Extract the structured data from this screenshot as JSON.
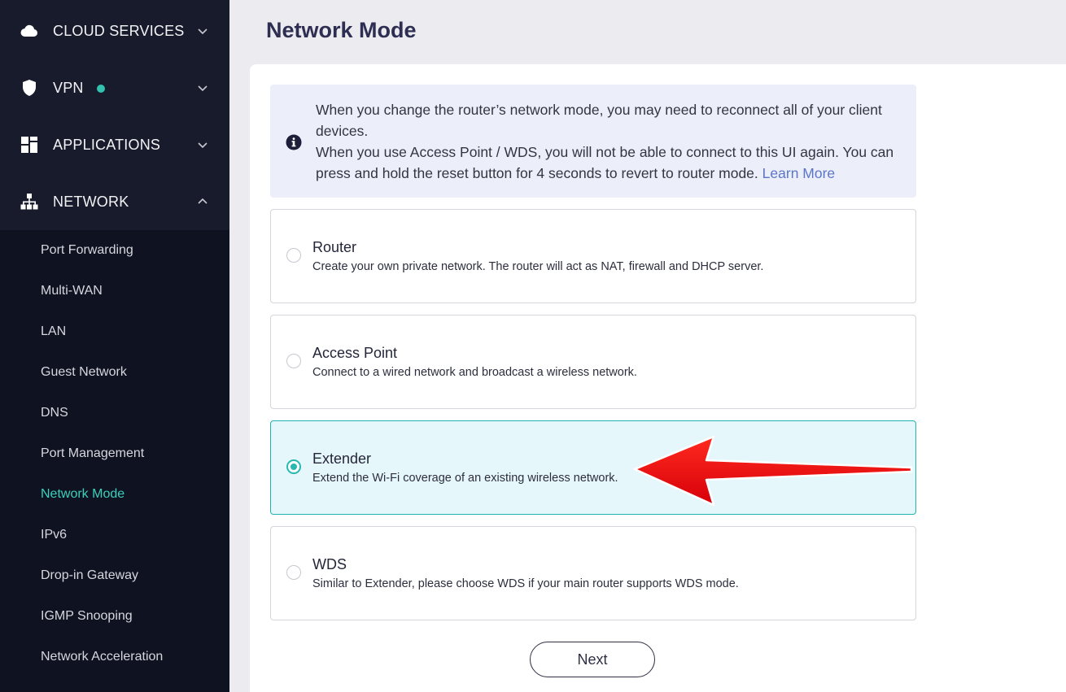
{
  "sidebar": {
    "sections": [
      {
        "label": "CLOUD SERVICES",
        "icon": "cloud-icon",
        "expanded": false
      },
      {
        "label": "VPN",
        "icon": "shield-icon",
        "expanded": false,
        "status_color": "#33c2b0"
      },
      {
        "label": "APPLICATIONS",
        "icon": "apps-grid-icon",
        "expanded": false
      },
      {
        "label": "NETWORK",
        "icon": "network-icon",
        "expanded": true
      }
    ],
    "network_items": [
      "Port Forwarding",
      "Multi-WAN",
      "LAN",
      "Guest Network",
      "DNS",
      "Port Management",
      "Network Mode",
      "IPv6",
      "Drop-in Gateway",
      "IGMP Snooping",
      "Network Acceleration"
    ],
    "active_item": "Network Mode"
  },
  "page": {
    "title": "Network Mode"
  },
  "info": {
    "icon": "info-icon",
    "line1": "When you change the router’s network mode, you may need to reconnect all of your client devices.",
    "line2": "When you use Access Point / WDS, you will not be able to connect to this UI again. You can press and hold the reset button for 4 seconds to revert to router mode.",
    "learn_more": "Learn More"
  },
  "options": [
    {
      "title": "Router",
      "desc": "Create your own private network. The router will act as NAT, firewall and DHCP server.",
      "selected": false
    },
    {
      "title": "Access Point",
      "desc": "Connect to a wired network and broadcast a wireless network.",
      "selected": false
    },
    {
      "title": "Extender",
      "desc": "Extend the Wi-Fi coverage of an existing wireless network.",
      "selected": true
    },
    {
      "title": "WDS",
      "desc": "Similar to Extender, please choose WDS if your main router supports WDS mode.",
      "selected": false
    }
  ],
  "actions": {
    "next_label": "Next"
  },
  "colors": {
    "accent": "#27b8b0",
    "sidebar_bg": "#181b2c",
    "annotation_arrow": "#e8000b"
  }
}
